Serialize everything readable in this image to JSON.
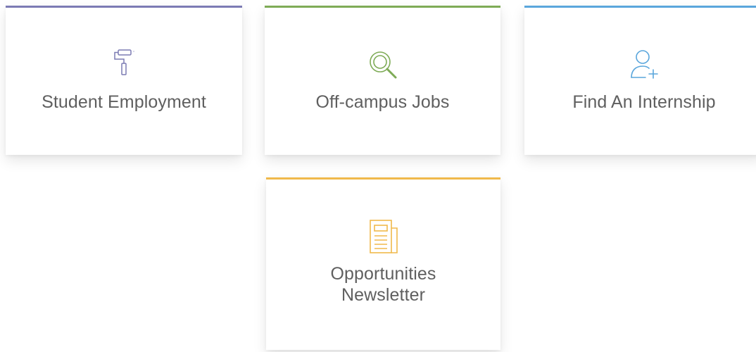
{
  "cards": [
    {
      "label": "Student Employment",
      "icon": "paint-roller-icon",
      "accent": "#7c7bb4"
    },
    {
      "label": "Off-campus Jobs",
      "icon": "magnifying-glass-icon",
      "accent": "#7eab56"
    },
    {
      "label": "Find An Internship",
      "icon": "add-user-icon",
      "accent": "#5aa6dc"
    },
    {
      "label_line1": "Opportunities",
      "label_line2": "Newsletter",
      "icon": "newspaper-icon",
      "accent": "#f0b94b"
    }
  ]
}
